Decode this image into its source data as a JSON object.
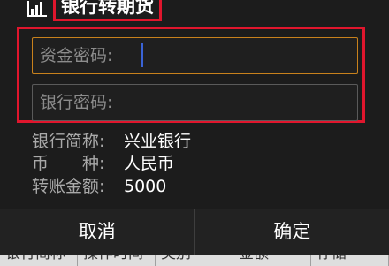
{
  "dialog": {
    "title": "银行转期货",
    "fields": {
      "fund_password_placeholder": "资金密码:",
      "bank_password_placeholder": "银行密码:"
    },
    "info": [
      {
        "label": "银行简称:",
        "value": "兴业银行"
      },
      {
        "label": "币　　种:",
        "value": "人民币"
      },
      {
        "label": "转账金额:",
        "value": "5000"
      }
    ],
    "buttons": {
      "cancel": "取消",
      "confirm": "确定"
    }
  },
  "background_table": {
    "cells": [
      "银行简称",
      "操作时间",
      "类别",
      "金额",
      "存储"
    ]
  },
  "icons": {
    "title_icon": "bar-chart-icon"
  },
  "colors": {
    "highlight_red": "#e0162d",
    "focus_border": "#c8811c",
    "caret": "#3a63d6"
  }
}
